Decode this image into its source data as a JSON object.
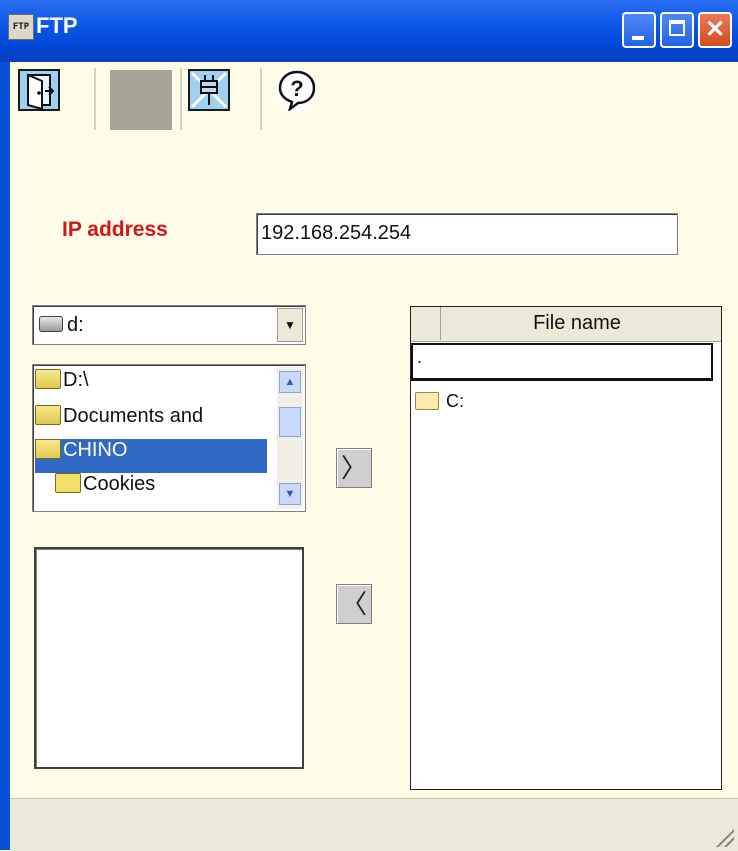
{
  "window": {
    "app_icon_text": "FTP",
    "title": "FTP",
    "close_glyph": "✕"
  },
  "toolbar": {
    "buttons": [
      {
        "name": "exit-door-icon"
      },
      {
        "name": "blank"
      },
      {
        "name": "plug-disconnect-icon"
      },
      {
        "name": "help-icon",
        "glyph": "?"
      }
    ]
  },
  "connection": {
    "ip_label": "IP address",
    "ip_value": "192.168.254.254"
  },
  "local": {
    "drive": "d:",
    "dropdown_glyph": "▼",
    "directories": [
      {
        "label": "D:\\"
      },
      {
        "label": "Documents and"
      },
      {
        "label": "CHINO",
        "selected": true
      },
      {
        "label": "Cookies"
      }
    ],
    "scroll_up_glyph": "▲",
    "scroll_down_glyph": "▼"
  },
  "transfer": {
    "upload_glyph": "〉",
    "download_glyph": "〈"
  },
  "remote": {
    "column_header": "File name",
    "path_value": ".",
    "items": [
      {
        "label": "C:"
      }
    ]
  },
  "colors": {
    "title_bar": "#0046d6",
    "client_background": "#fffde8",
    "ip_label": "#d4141a",
    "selection": "#316ac5"
  }
}
